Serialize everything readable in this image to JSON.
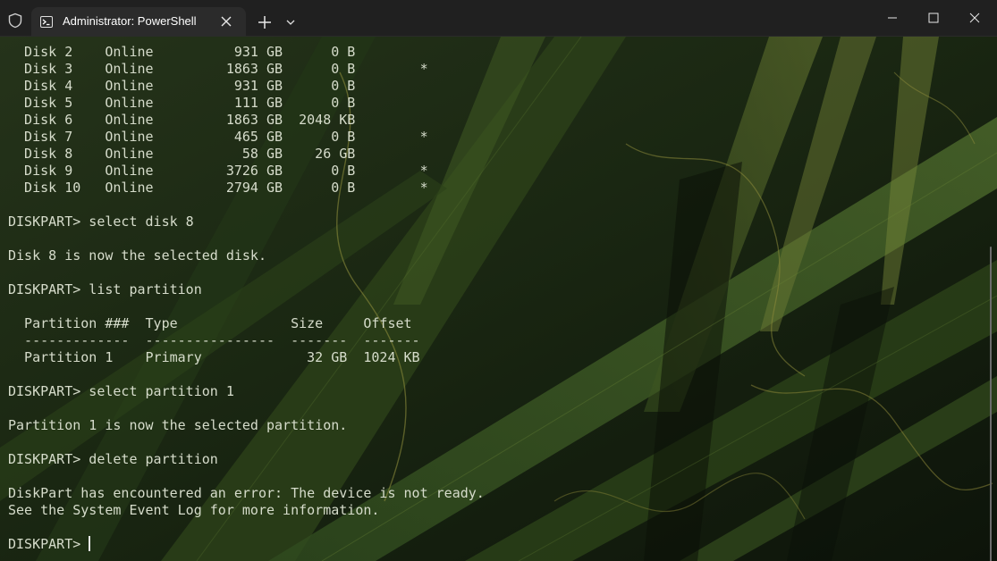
{
  "window": {
    "tab_title": "Administrator: PowerShell",
    "icons": {
      "security": "shield-icon",
      "tab": "powershell-icon",
      "tab_close": "close-icon",
      "new_tab": "plus-icon",
      "dropdown": "chevron-down-icon",
      "minimize": "minimize-icon",
      "maximize": "maximize-icon",
      "close": "close-icon"
    },
    "colors": {
      "titlebar": "#202020",
      "tab": "#2b2b2b",
      "text": "#d6dccb"
    }
  },
  "terminal": {
    "lines": [
      "  Disk 2    Online          931 GB      0 B",
      "  Disk 3    Online         1863 GB      0 B        *",
      "  Disk 4    Online          931 GB      0 B",
      "  Disk 5    Online          111 GB      0 B",
      "  Disk 6    Online         1863 GB  2048 KB",
      "  Disk 7    Online          465 GB      0 B        *",
      "  Disk 8    Online           58 GB    26 GB",
      "  Disk 9    Online         3726 GB      0 B        *",
      "  Disk 10   Online         2794 GB      0 B        *",
      "",
      "DISKPART> select disk 8",
      "",
      "Disk 8 is now the selected disk.",
      "",
      "DISKPART> list partition",
      "",
      "  Partition ###  Type              Size     Offset",
      "  -------------  ----------------  -------  -------",
      "  Partition 1    Primary             32 GB  1024 KB",
      "",
      "DISKPART> select partition 1",
      "",
      "Partition 1 is now the selected partition.",
      "",
      "DISKPART> delete partition",
      "",
      "DiskPart has encountered an error: The device is not ready.",
      "See the System Event Log for more information.",
      ""
    ],
    "prompt": "DISKPART> "
  }
}
